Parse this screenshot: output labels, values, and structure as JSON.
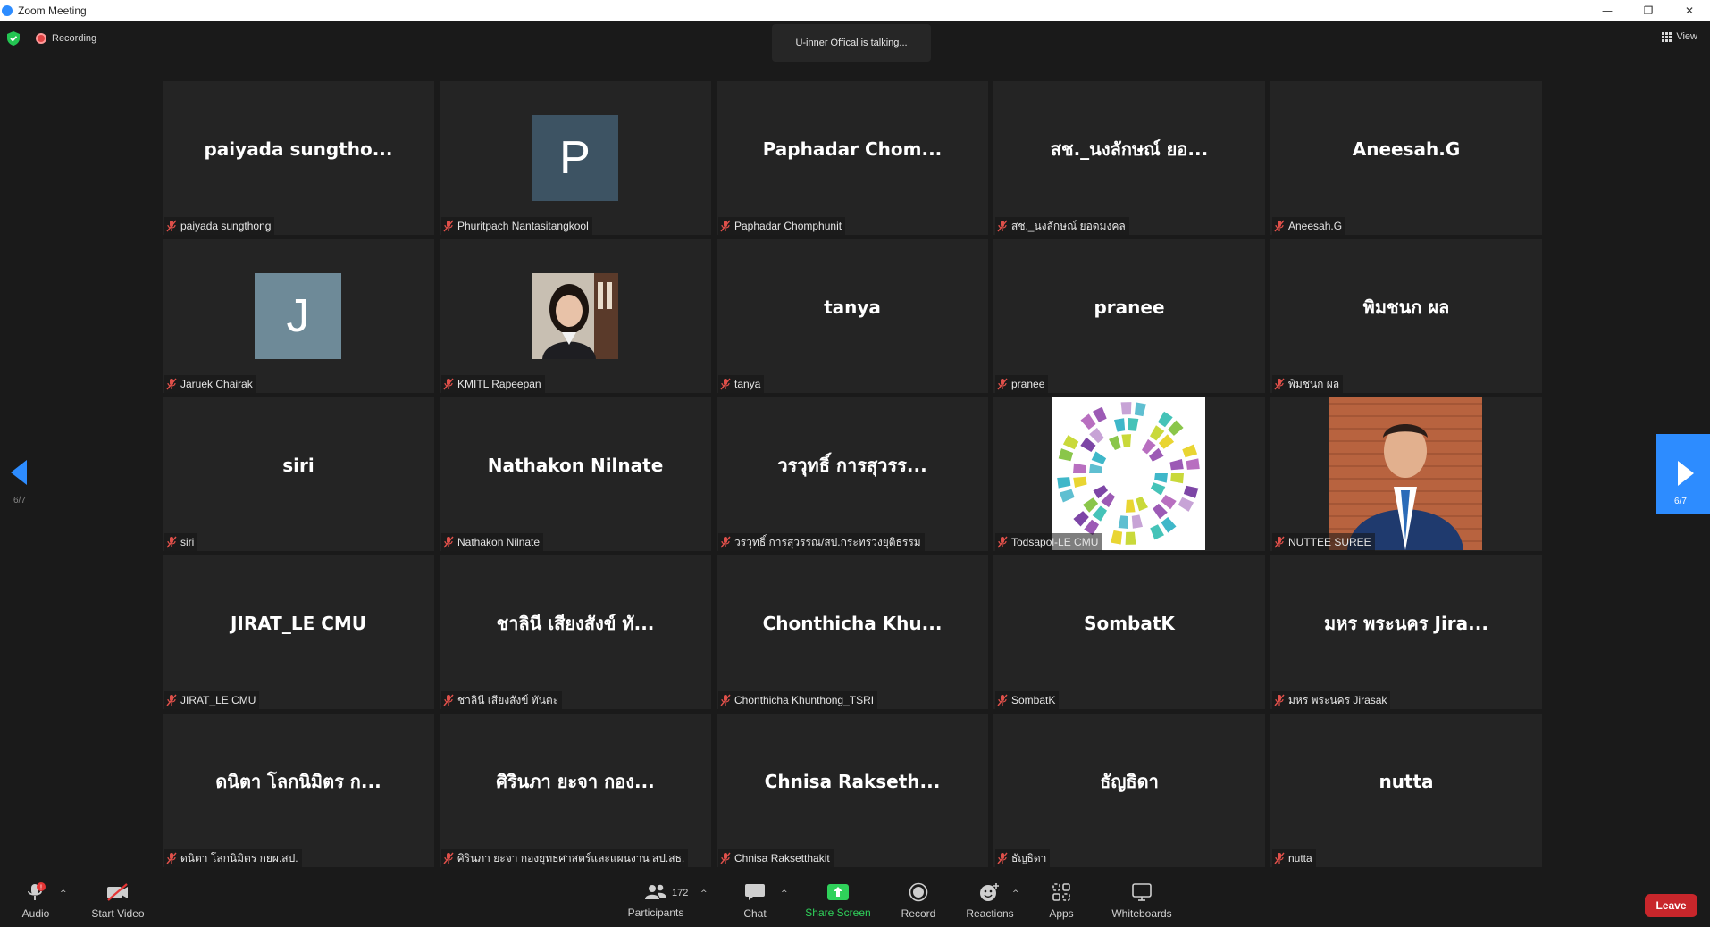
{
  "window": {
    "title": "Zoom Meeting",
    "minimize": "—",
    "restore": "❐",
    "close": "✕"
  },
  "topbar": {
    "recording_label": "Recording",
    "talking_text": "U-inner Offical is talking...",
    "view_label": "View"
  },
  "pagination": {
    "left_label": "6/7",
    "right_label": "6/7"
  },
  "tiles": [
    {
      "big": "paiyada  sungtho...",
      "name": "paiyada sungthong"
    },
    {
      "letter": "P",
      "name": "Phuritpach Nantasitangkool",
      "avatar_color": "#3d5363"
    },
    {
      "big": "Paphadar  Chom...",
      "name": "Paphadar Chomphunit"
    },
    {
      "big": "สช._นงลักษณ์ ยอ...",
      "name": "สช._นงลักษณ์ ยอดมงคล"
    },
    {
      "big": "Aneesah.G",
      "name": "Aneesah.G"
    },
    {
      "letter": "J",
      "name": "Jaruek Chairak",
      "avatar_color": "#6e8a98"
    },
    {
      "photo": "woman",
      "name": "KMITL Rapeepan"
    },
    {
      "big": "tanya",
      "name": "tanya"
    },
    {
      "big": "pranee",
      "name": "pranee"
    },
    {
      "big": "พิมชนก ผล",
      "name": "พิมชนก ผล"
    },
    {
      "big": "siri",
      "name": "siri"
    },
    {
      "big": "Nathakon Nilnate",
      "name": "Nathakon Nilnate"
    },
    {
      "big": "วรวุทธิ์ การสุวรร...",
      "name": "วรวุทธิ์ การสุวรรณ/สป.กระทรวงยุติธรรม"
    },
    {
      "photo": "logo",
      "name": "Todsapol-LE CMU"
    },
    {
      "photo": "man",
      "name": "NUTTEE SUREE"
    },
    {
      "big": "JIRAT_LE CMU",
      "name": "JIRAT_LE CMU"
    },
    {
      "big": "ชาลินี  เสียงสังข์ ทั...",
      "name": "ชาลินี  เสียงสังข์ ทันตะ"
    },
    {
      "big": "Chonthicha  Khu...",
      "name": "Chonthicha Khunthong_TSRI"
    },
    {
      "big": "SombatK",
      "name": "SombatK"
    },
    {
      "big": "มหร พระนคร Jira...",
      "name": "มหร พระนคร Jirasak"
    },
    {
      "big": "ดนิตา โลกนิมิตร ก...",
      "name": "ดนิตา โลกนิมิตร กยผ.สป."
    },
    {
      "big": "ศิรินภา ยะจา กอง...",
      "name": "ศิรินภา ยะจา กองยุทธศาสตร์และแผนงาน สป.สธ."
    },
    {
      "big": "Chnisa  Rakseth...",
      "name": "Chnisa Raksetthakit"
    },
    {
      "big": "ธัญธิดา",
      "name": "ธัญธิดา"
    },
    {
      "big": "nutta",
      "name": "nutta"
    }
  ],
  "toolbar": {
    "audio_label": "Audio",
    "audio_badge": "!",
    "video_label": "Start Video",
    "participants_label": "Participants",
    "participants_count": "172",
    "chat_label": "Chat",
    "share_label": "Share Screen",
    "record_label": "Record",
    "reactions_label": "Reactions",
    "apps_label": "Apps",
    "whiteboards_label": "Whiteboards",
    "leave_label": "Leave"
  },
  "colors": {
    "share_green": "#2fd15a",
    "leave_red": "#c8262b",
    "nav_blue": "#2d8cff"
  }
}
